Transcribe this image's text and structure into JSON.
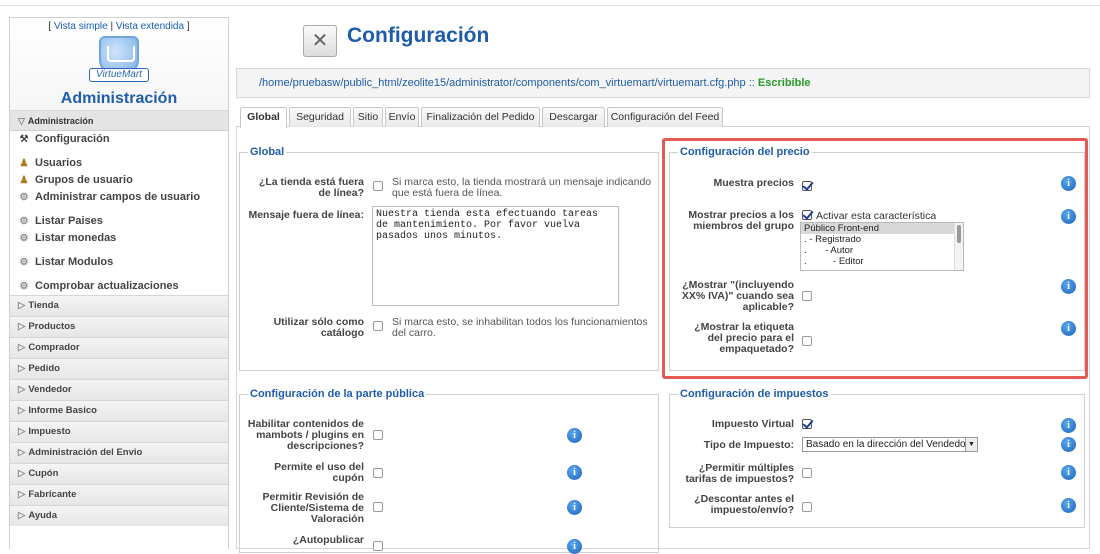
{
  "sidebar": {
    "views": {
      "open": "[",
      "simple": "Vista simple",
      "sep": "|",
      "extended": "Vista extendida",
      "close": "]"
    },
    "logo_text": "VirtueMart",
    "title": "Administración",
    "active_section": "Administración",
    "items": [
      {
        "label": "Configuración",
        "icon": "wrench-icon"
      },
      {
        "label": "Usuarios",
        "icon": "users-icon"
      },
      {
        "label": "Grupos de usuario",
        "icon": "users-icon"
      },
      {
        "label": "Administrar campos de usuario",
        "icon": "gear-icon"
      },
      {
        "label": "Listar Paises",
        "icon": "gear-icon"
      },
      {
        "label": "Listar monedas",
        "icon": "gear-icon"
      },
      {
        "label": "Listar Modulos",
        "icon": "gear-icon"
      },
      {
        "label": "Comprobar actualizaciones",
        "icon": "gear-icon"
      }
    ],
    "categories": [
      "Tienda",
      "Productos",
      "Comprador",
      "Pedido",
      "Vendedor",
      "Informe Basico",
      "Impuesto",
      "Administración del Envio",
      "Cupón",
      "Fabricante",
      "Ayuda"
    ]
  },
  "header": {
    "title": "Configuración",
    "path": "/home/pruebasw/public_html/zeolite15/administrator/components/com_virtuemart/virtuemart.cfg.php",
    "path_sep": "::",
    "status": "Escribible"
  },
  "tabs": [
    "Global",
    "Seguridad",
    "Sitio",
    "Envío",
    "Finalización del Pedido",
    "Descargar",
    "Configuración del Feed"
  ],
  "global": {
    "legend": "Global",
    "offline_label": "¿La tienda está fuera de línea?",
    "offline_desc": "Si marca esto, la tienda mostrará un mensaje indicando que está fuera de línea.",
    "offline_msg_label": "Mensaje fuera de línea:",
    "offline_msg_value": "Nuestra tienda esta efectuando tareas de mantenimiento. Por favor vuelva pasados unos minutos.",
    "catalog_label": "Utilizar sólo como catálogo",
    "catalog_desc": "Si marca esto, se inhabilitan todos los funcionamientos del carro."
  },
  "price": {
    "legend": "Configuración del precio",
    "show_prices_label": "Muestra precios",
    "show_prices_checked": true,
    "group_label": "Mostrar precios a los miembros del grupo",
    "group_enable_label": "Activar esta característica",
    "group_enable_checked": true,
    "group_options": [
      "Público Front-end",
      ". - Registrado",
      ".       - Autor",
      ".          - Editor"
    ],
    "include_tax_label": "¿Mostrar \"(incluyendo XX% IVA)\" cuando sea aplicable?",
    "packaging_label": "¿Mostrar la etiqueta del precio para el empaquetado?"
  },
  "public": {
    "legend": "Configuración de la parte pública",
    "mambots_label": "Habilitar contenidos de mambots / plugins en descripciones?",
    "coupon_label": "Permite el uso del cupón",
    "review_label": "Permitir Revisión de Cliente/Sistema de Valoración",
    "autopublish_label": "¿Autopublicar"
  },
  "tax": {
    "legend": "Configuración de impuestos",
    "virtual_label": "Impuesto Virtual",
    "virtual_checked": true,
    "type_label": "Tipo de Impuesto:",
    "type_value": "Basado en la dirección del Vendedor",
    "multi_label": "¿Permitir múltiples tarifas de impuestos?",
    "discount_label": "¿Descontar antes el impuesto/envío?"
  },
  "colors": {
    "accent": "#1f5cab",
    "highlight": "#e55a53",
    "status_ok": "#2a9a2a"
  }
}
